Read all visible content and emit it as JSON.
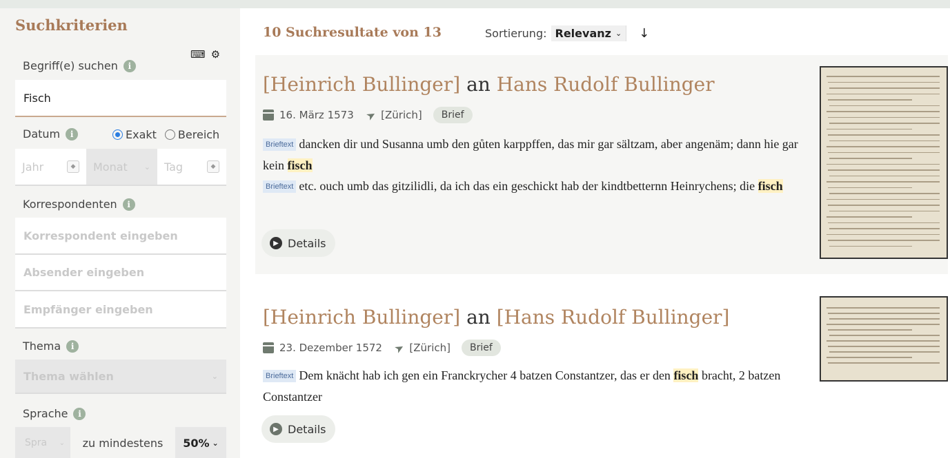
{
  "sidebar": {
    "title": "Suchkriterien",
    "search_label": "Begriff(e) suchen",
    "search_value": "Fisch",
    "date_label": "Datum",
    "date_mode_exact": "Exakt",
    "date_mode_range": "Bereich",
    "year_placeholder": "Jahr",
    "month_placeholder": "Monat",
    "day_placeholder": "Tag",
    "correspondents_label": "Korrespondenten",
    "correspondent_placeholder": "Korrespondent eingeben",
    "sender_placeholder": "Absender eingeben",
    "recipient_placeholder": "Empfänger eingeben",
    "topic_label": "Thema",
    "topic_placeholder": "Thema wählen",
    "language_label": "Sprache",
    "language_placeholder": "Spra",
    "language_min_text": "zu mindestens",
    "language_percent": "50%"
  },
  "main": {
    "results_title": "10 Suchresultate von 13",
    "sort_label": "Sortierung:",
    "sort_value": "Relevanz",
    "sort_direction_icon": "arrow-down-icon"
  },
  "results": [
    {
      "sender": "[Heinrich Bullinger]",
      "connector": "an",
      "recipient": "Hans Rudolf Bullinger",
      "date": "16. März 1573",
      "place": "[Zürich]",
      "type": "Brief",
      "snippets": [
        {
          "tag": "Brieftext",
          "text": "dancken dir und Susanna umb den gůten karppffen, das mir gar sältzam, aber angenäm; dann hie gar kein",
          "match": "fisch"
        },
        {
          "tag": "Brieftext",
          "text": "etc. ouch umb das gitzilidli, da ich das ein geschickt hab der kindtbetternn Heinrychens; die",
          "match": "fisch"
        }
      ],
      "details_label": "Details"
    },
    {
      "sender": "[Heinrich Bullinger]",
      "connector": "an",
      "recipient": "[Hans Rudolf Bullinger]",
      "date": "23. Dezember 1572",
      "place": "[Zürich]",
      "type": "Brief",
      "snippets": [
        {
          "tag": "Brieftext",
          "text": "Dem knächt hab ich gen ein Franckrycher 4 batzen Constantzer, das er den",
          "match": "fisch",
          "tail": "bracht, 2 batzen Constantzer"
        }
      ],
      "details_label": "Details"
    }
  ]
}
